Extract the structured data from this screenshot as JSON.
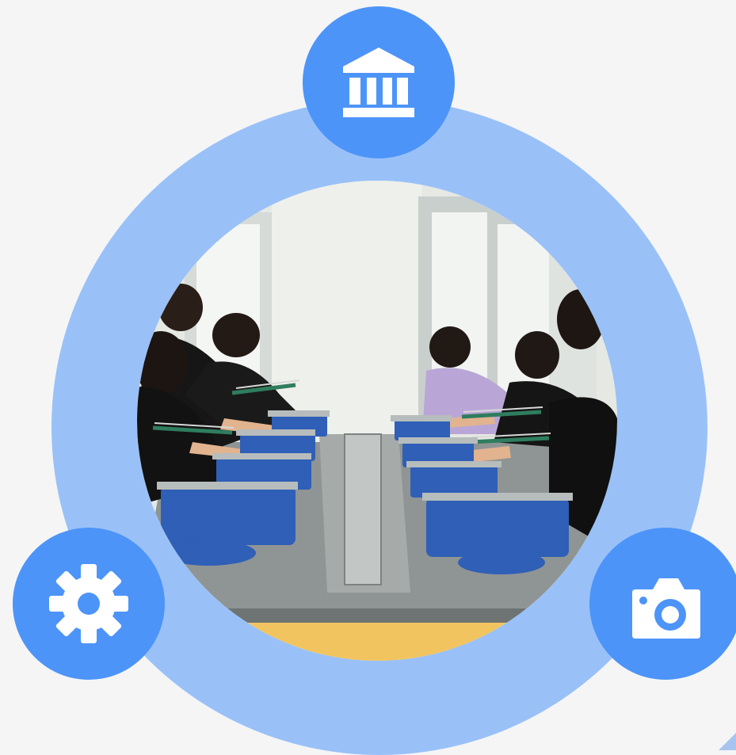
{
  "colors": {
    "ring": "#99c1f8",
    "badge": "#4d94f8",
    "icon": "#ffffff",
    "background": "#f5f5f5"
  },
  "badges": [
    {
      "id": "top",
      "icon": "bank-icon"
    },
    {
      "id": "left",
      "icon": "gear-icon"
    },
    {
      "id": "right",
      "icon": "camera-icon"
    }
  ],
  "photo": {
    "subject": "students-sawing-metal-at-workbench-with-blue-bench-vises"
  }
}
